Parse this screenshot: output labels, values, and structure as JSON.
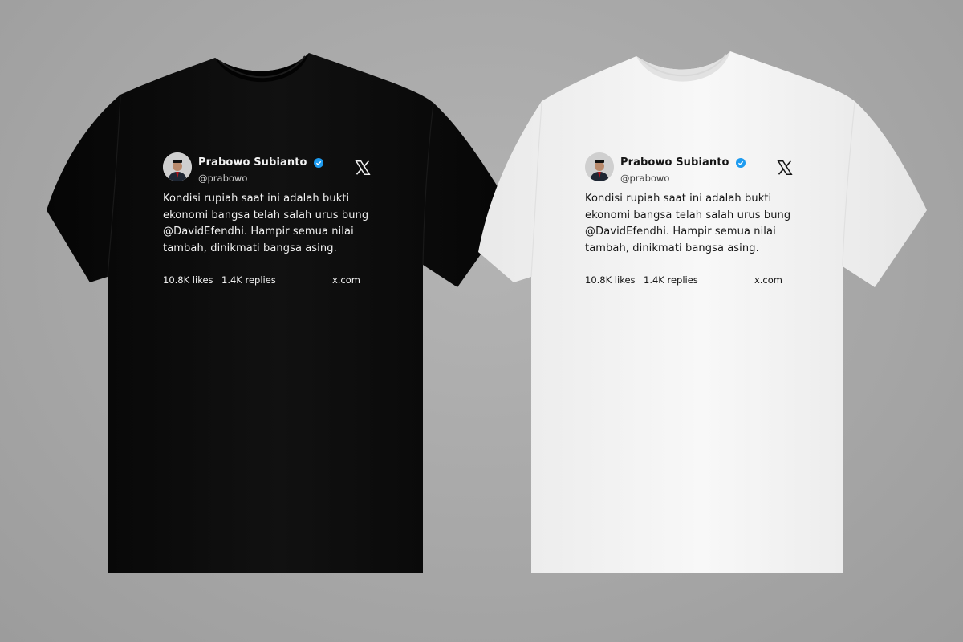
{
  "post": {
    "author_name": "Prabowo Subianto",
    "author_handle": "@prabowo",
    "text": "Kondisi rupiah saat ini adalah bukti ekonomi bangsa telah salah urus bung @DavidEfendhi. Hampir semua nilai tambah, dinikmati bangsa asing.",
    "likes": "10.8K likes",
    "replies": "1.4K replies",
    "site": "x.com"
  },
  "icons": {
    "verified": "verified-badge-icon",
    "logo": "x-logo-icon",
    "avatar": "profile-photo"
  },
  "colors": {
    "background": "#a8a8a8",
    "shirt_black": "#0d0d0d",
    "shirt_white": "#f4f4f4",
    "verified_blue": "#1d9bf0"
  }
}
